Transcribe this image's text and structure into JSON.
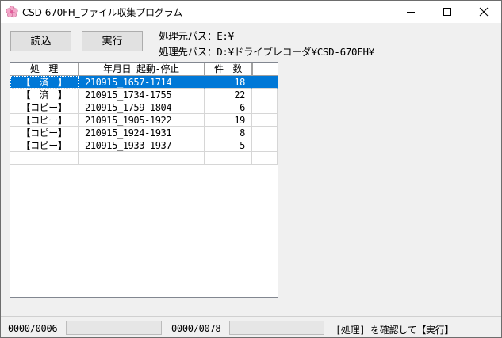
{
  "window": {
    "title": "CSD-670FH_ファイル収集プログラム",
    "icon": "sakura-flower-icon",
    "controls": [
      "minimize",
      "maximize",
      "close"
    ]
  },
  "buttons": {
    "load_label": "読込",
    "run_label": "実行"
  },
  "paths": {
    "source": "処理元パス：E:¥",
    "destination": "処理先パス：D:¥ドライブレコーダ¥CSD-670FH¥"
  },
  "list": {
    "columns": [
      "処　理",
      "年月日 起動-停止",
      "件　数",
      ""
    ],
    "rows": [
      {
        "status": "【　済　】",
        "datetime": "210915_1657-1714",
        "count": "18",
        "selected": true
      },
      {
        "status": "【　済　】",
        "datetime": "210915_1734-1755",
        "count": "22",
        "selected": false
      },
      {
        "status": "【コピー】",
        "datetime": "210915_1759-1804",
        "count": "6",
        "selected": false
      },
      {
        "status": "【コピー】",
        "datetime": "210915_1905-1922",
        "count": "19",
        "selected": false
      },
      {
        "status": "【コピー】",
        "datetime": "210915_1924-1931",
        "count": "8",
        "selected": false
      },
      {
        "status": "【コピー】",
        "datetime": "210915_1933-1937",
        "count": "5",
        "selected": false
      },
      {
        "status": "",
        "datetime": "",
        "count": "",
        "selected": false
      }
    ]
  },
  "status": {
    "file_progress": "0000/0006",
    "total_progress": "0000/0078",
    "message": "[処理] を確認して【実行】"
  },
  "colors": {
    "selection": "#0078d7",
    "window_bg": "#f0f0f0"
  }
}
